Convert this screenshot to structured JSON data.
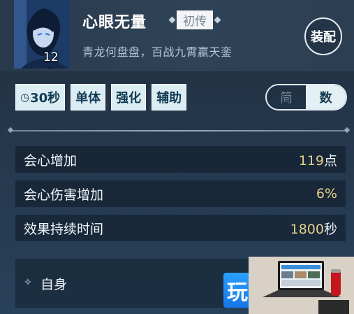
{
  "skill": {
    "level": "12级",
    "name": "心眼无量",
    "tier": "初传",
    "description": "青龙何盘盘，百战九霄嬴天銮",
    "equip_label": "装配"
  },
  "tags": {
    "cooldown": "30秒",
    "items": [
      "单体",
      "强化",
      "辅助"
    ]
  },
  "view_toggle": {
    "options": [
      "简",
      "数"
    ],
    "selected": "数"
  },
  "stats": [
    {
      "label": "会心增加",
      "value": "119",
      "unit": "点"
    },
    {
      "label": "会心伤害增加",
      "value": "6%",
      "unit": ""
    },
    {
      "label": "效果持续时间",
      "value": "1800",
      "unit": "秒"
    }
  ],
  "target": {
    "label": "自身"
  },
  "overlay": {
    "logo_char": "玩"
  },
  "colors": {
    "accent_gold": "#e5cf8a",
    "tag_bg": "#dcecf3"
  }
}
